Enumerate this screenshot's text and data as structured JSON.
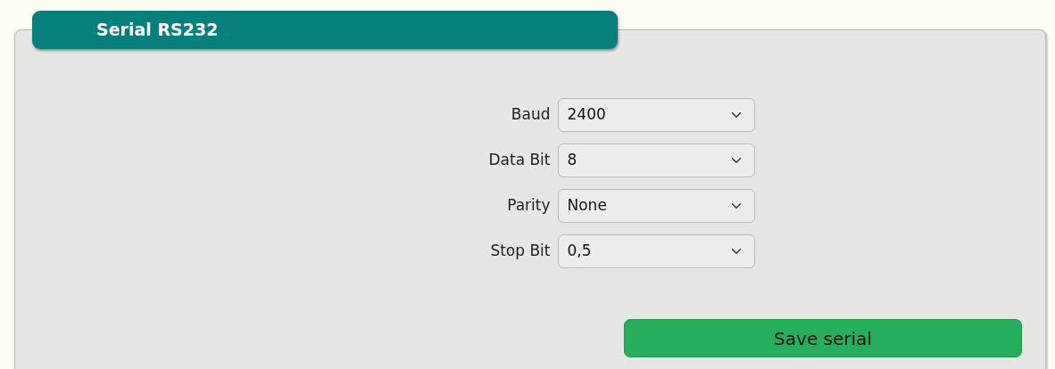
{
  "panel": {
    "title": "Serial RS232"
  },
  "fields": [
    {
      "label": "Baud",
      "value": "2400"
    },
    {
      "label": "Data Bit",
      "value": "8"
    },
    {
      "label": "Parity",
      "value": "None"
    },
    {
      "label": "Stop Bit",
      "value": "0,5"
    }
  ],
  "save_button": "Save serial"
}
